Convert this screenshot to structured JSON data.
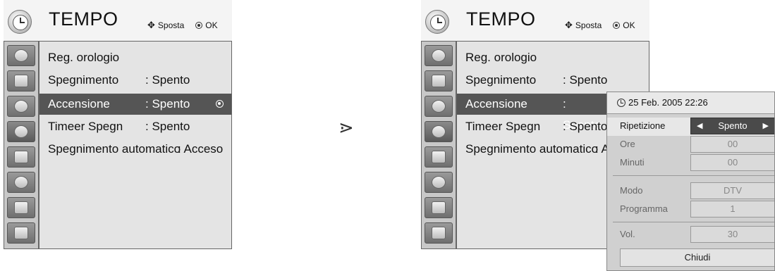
{
  "menu": {
    "title": "TEMPO",
    "hint_move": "Sposta",
    "hint_ok": "OK",
    "items": [
      {
        "label": "Reg. orologio",
        "value": ""
      },
      {
        "label": "Spegnimento",
        "value": ": Spento"
      },
      {
        "label": "Accensione",
        "value": ": Spento"
      },
      {
        "label": "Timeer Spegn",
        "value": ": Spento"
      },
      {
        "label": "Spegnimento automatico",
        "value": ": Acceso"
      }
    ],
    "right_items": [
      {
        "label": "Reg. orologio",
        "value": ""
      },
      {
        "label": "Spegnimento",
        "value": ": Spento"
      },
      {
        "label": "Accensione",
        "value": ": Spento"
      },
      {
        "label": "Timeer Spegn",
        "value": ": Spento"
      },
      {
        "label": "Spegnimento automatico",
        "value": ": A"
      }
    ],
    "selected_item": "Accensione",
    "icons": [
      "satellite-dish-icon",
      "screen-icon",
      "speaker-icon",
      "clock-icon",
      "calendar-icon",
      "lock-icon",
      "cable-icon",
      "photo-icon"
    ]
  },
  "separator": "⋗",
  "popup": {
    "datetime": "25 Feb. 2005 22:26",
    "rows": [
      {
        "label": "Ripetizione",
        "value": "Spento"
      },
      {
        "label": "Ore",
        "value": "00"
      },
      {
        "label": "Minuti",
        "value": "00"
      },
      {
        "label": "Modo",
        "value": "DTV"
      },
      {
        "label": "Programma",
        "value": "1"
      },
      {
        "label": "Vol.",
        "value": "30"
      }
    ],
    "close_label": "Chiudi"
  }
}
